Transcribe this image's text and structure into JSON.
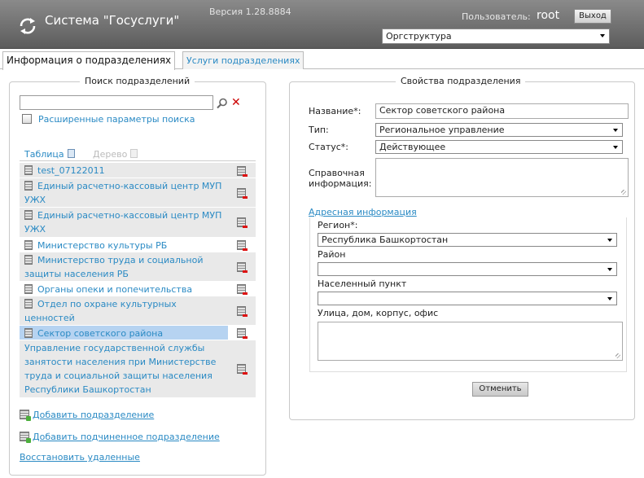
{
  "header": {
    "app_title": "Система \"Госуслуги\"",
    "version": "Версия 1.28.8884",
    "user_label": "Пользователь:",
    "user_name": "root",
    "logout_label": "Выход",
    "org_select_value": "Оргструктура"
  },
  "tabs": [
    {
      "label": "Информация о подразделениях"
    },
    {
      "label": "Услуги подразделениях"
    }
  ],
  "search_panel": {
    "legend": "Поиск подразделений",
    "search_value": "",
    "advanced_label": "Расширенные параметры поиска",
    "view_table_label": "Таблица",
    "view_tree_label": "Дерево"
  },
  "units": [
    {
      "name": "test_07122011"
    },
    {
      "name": "Единый расчетно-кассовый центр МУП УЖХ"
    },
    {
      "name": "Единый расчетно-кассовый центр МУП УЖХ"
    },
    {
      "name": "Министерство культуры РБ"
    },
    {
      "name": "Министерство труда и социальной защиты населения РБ"
    },
    {
      "name": "Органы опеки и попечительства"
    },
    {
      "name": "Отдел по охране культурных ценностей"
    },
    {
      "name": "Сектор советского района",
      "selected": true
    },
    {
      "name": "Управление государственной службы занятости населения при Министерстве труда и социальной защиты населения Республики Башкортостан"
    }
  ],
  "actions": {
    "add_unit": "Добавить подразделение",
    "add_subunit": "Добавить подчиненное подразделение",
    "restore_deleted": "Восстановить удаленные"
  },
  "properties": {
    "legend": "Свойства подразделения",
    "name_label": "Название*:",
    "name_value": "Сектор советского района",
    "type_label": "Тип:",
    "type_value": "Региональное управление",
    "status_label": "Статус*:",
    "status_value": "Действующее",
    "info_label_line1": "Справочная",
    "info_label_line2": "информация:",
    "info_value": "",
    "address_legend": "Адресная информация",
    "region_label": "Регион*:",
    "region_value": "Республика Башкортостан",
    "district_label": "Район",
    "district_value": "",
    "locality_label": "Населенный пункт",
    "locality_value": "",
    "street_label": "Улица, дом, корпус, офис",
    "street_value": "",
    "cancel_label": "Отменить"
  }
}
